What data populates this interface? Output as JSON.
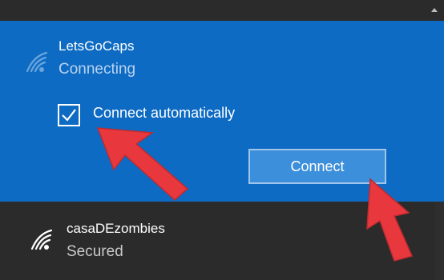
{
  "networks": [
    {
      "ssid": "LetsGoCaps",
      "status": "Connecting",
      "icon": "wifi-icon",
      "connect_automatically": {
        "label": "Connect automatically",
        "checked": true
      },
      "connect_button_label": "Connect"
    },
    {
      "ssid": "casaDEzombies",
      "status": "Secured",
      "icon": "wifi-secured-icon"
    }
  ],
  "colors": {
    "panel_selected": "#0d6bc4",
    "panel_dark": "#2b2b2b",
    "button_fill": "#3c8fdb",
    "annotation_arrow": "#e8383d"
  }
}
